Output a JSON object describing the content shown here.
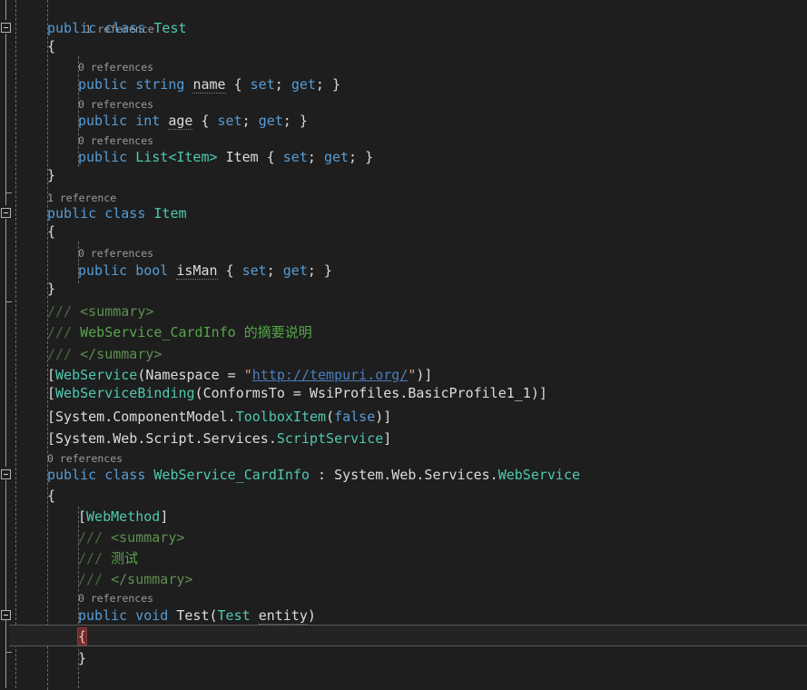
{
  "editor": {
    "background": "#1e1e1e",
    "foreground": "#dcdcdc",
    "current_line_background": "#232323",
    "current_line_border": "#5a5a5a",
    "brace_highlight_background": "#6e2b2b",
    "keyword_color": "#569cd6",
    "type_color": "#4ec9b0",
    "comment_color": "#57a64a",
    "string_color": "#d69d85",
    "link_color": "#4a7ebb",
    "codelens_color": "#9b9b9b"
  },
  "codelens": {
    "one_reference": "1 reference",
    "zero_references": "0 references"
  },
  "lines": {
    "l1_lens": "1 reference",
    "l2_public": "public",
    "l2_class": "class",
    "l2_name": "Test",
    "l3_brace": "{",
    "l4_lens": "0 references",
    "l5_public": "public",
    "l5_type": "string",
    "l5_name": "name",
    "l5_accessors": "{ set; get; }",
    "l6_lens": "0 references",
    "l7_public": "public",
    "l7_type": "int",
    "l7_name": "age",
    "l7_accessors": "{ set; get; }",
    "l8_lens": "0 references",
    "l9_public": "public",
    "l9_type": "List<Item>",
    "l9_name": "Item",
    "l9_accessors": "{ set; get; }",
    "l10_brace": "}",
    "l11_lens": "1 reference",
    "l12_public": "public",
    "l12_class": "class",
    "l12_name": "Item",
    "l13_brace": "{",
    "l14_lens": "0 references",
    "l15_public": "public",
    "l15_type": "bool",
    "l15_name": "isMan",
    "l15_accessors": "{ set; get; }",
    "l16_brace": "}",
    "l17_slashes": "///",
    "l17_tag": "<summary>",
    "l18_slashes": "///",
    "l18_text": "WebService_CardInfo 的摘要说明",
    "l19_slashes": "///",
    "l19_tag": "</summary>",
    "l20_open": "[",
    "l20_attr": "WebService",
    "l20_mid": "(Namespace = ",
    "l20_quote1": "\"",
    "l20_url": "http://tempuri.org/",
    "l20_quote2": "\"",
    "l20_close": ")]",
    "l21_open": "[",
    "l21_attr": "WebServiceBinding",
    "l21_rest": "(ConformsTo = WsiProfiles.BasicProfile1_1)]",
    "l22_open": "[System.ComponentModel.",
    "l22_attr": "ToolboxItem",
    "l22_paren1": "(",
    "l22_false": "false",
    "l22_close": ")]",
    "l23_open": "[System.Web.Script.Services.",
    "l23_attr": "ScriptService",
    "l23_close": "]",
    "l24_lens": "0 references",
    "l25_public": "public",
    "l25_class": "class",
    "l25_name": "WebService_CardInfo",
    "l25_colon": " : ",
    "l25_base_ns": "System.Web.Services.",
    "l25_base": "WebService",
    "l26_brace": "{",
    "l27_open": "[",
    "l27_attr": "WebMethod",
    "l27_close": "]",
    "l28_slashes": "///",
    "l28_tag": "<summary>",
    "l29_slashes": "///",
    "l29_text": "测试",
    "l30_slashes": "///",
    "l30_tag": "</summary>",
    "l31_lens": "0 references",
    "l32_public": "public",
    "l32_void": "void",
    "l32_method": "Test",
    "l32_paren1": "(",
    "l32_ptype": "Test",
    "l32_pname": "entity",
    "l32_paren2": ")",
    "l33_brace": "{",
    "l34_brace": "}"
  }
}
